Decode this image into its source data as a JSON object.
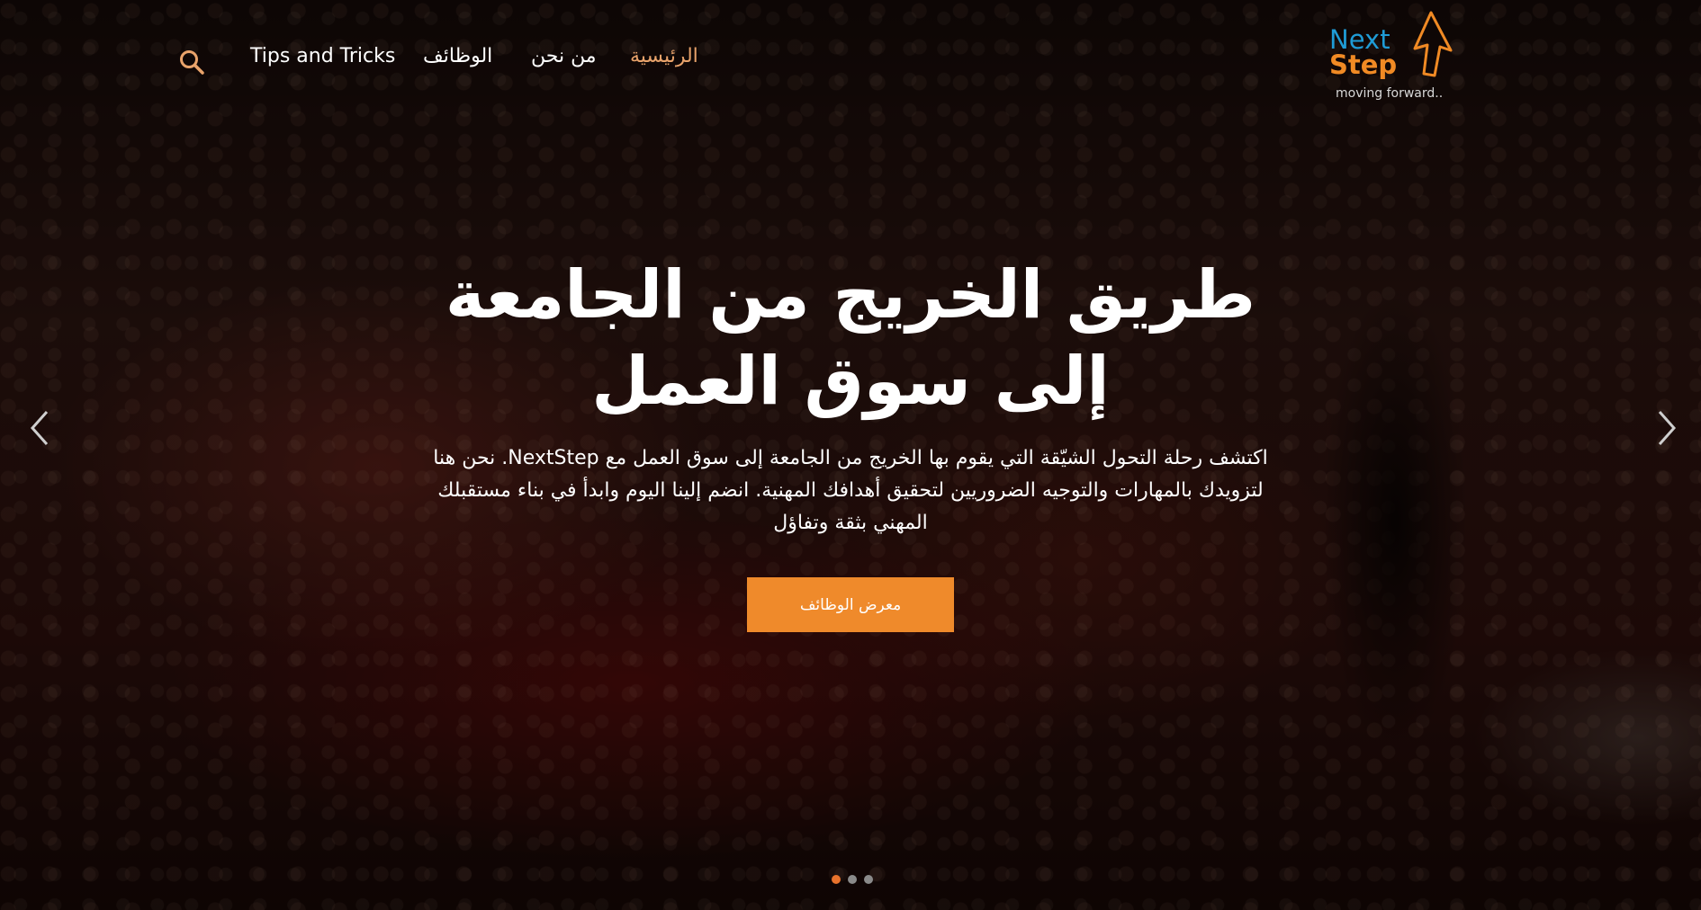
{
  "brand": {
    "logo_line1": "Next",
    "logo_line2": "Step",
    "tagline": "moving forward..",
    "colors": {
      "blue": "#1f9cd6",
      "orange": "#f08a24"
    }
  },
  "header": {
    "nav": [
      {
        "label": "الرئيسية",
        "active": true
      },
      {
        "label": "من نحن",
        "active": false
      },
      {
        "label": "الوظائف",
        "active": false
      },
      {
        "label": "Tips and Tricks",
        "active": false
      }
    ],
    "search_icon": "search-icon",
    "accent_color": "#e9a36b"
  },
  "hero": {
    "headline": "طريق الخريج من الجامعة إلى سوق العمل",
    "description": "اكتشف رحلة التحول الشيّقة التي يقوم بها الخريج من الجامعة إلى سوق العمل مع NextStep. نحن هنا لتزويدك بالمهارات والتوجيه الضروريين لتحقيق أهدافك المهنية. انضم إلينا اليوم وابدأ في بناء مستقبلك المهني بثقة وتفاؤل",
    "cta_label": "معرض الوظائف",
    "cta_color": "#ef8a2b"
  },
  "carousel": {
    "prev_icon": "chevron-left-icon",
    "next_icon": "chevron-right-icon",
    "slides_total": 3,
    "active_slide": 1,
    "dot_active_color": "#e8722c",
    "dot_inactive_color": "#8a8a8a"
  }
}
